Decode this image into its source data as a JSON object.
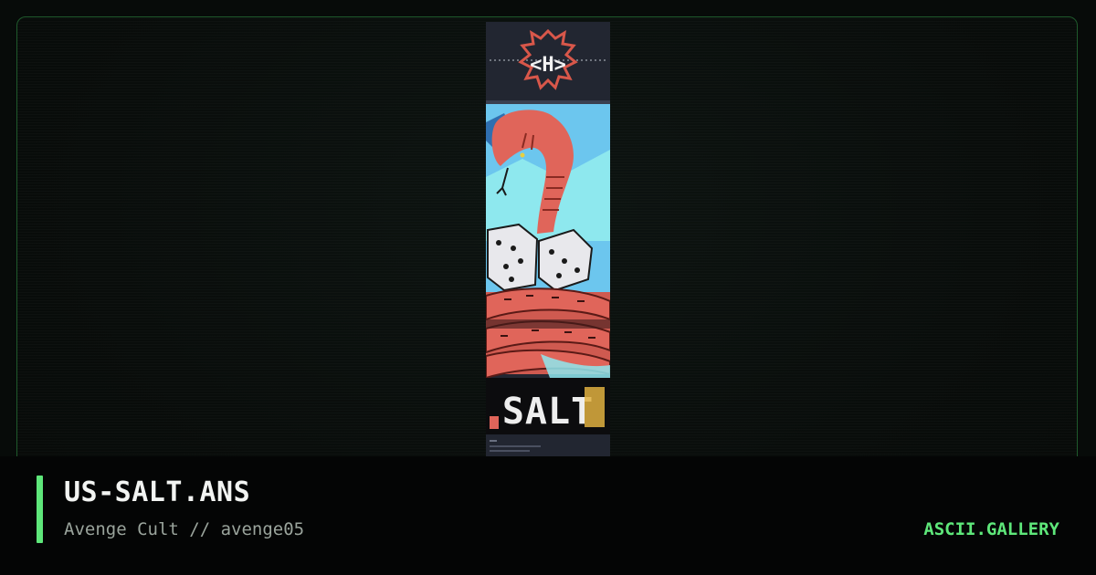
{
  "artwork": {
    "title": "US-SALT.ANS",
    "byline": "Avenge Cult // avenge05",
    "header_logo_text": "<H>",
    "art_text": "SALT"
  },
  "site": {
    "name": "ASCII.GALLERY"
  },
  "colors": {
    "accent": "#5ee77a",
    "frame_border": "#1f5a2c",
    "snake": "#e0655a",
    "sky_blue": "#6cc6ee",
    "cyan": "#8ee8ee",
    "gold": "#e0b040"
  }
}
